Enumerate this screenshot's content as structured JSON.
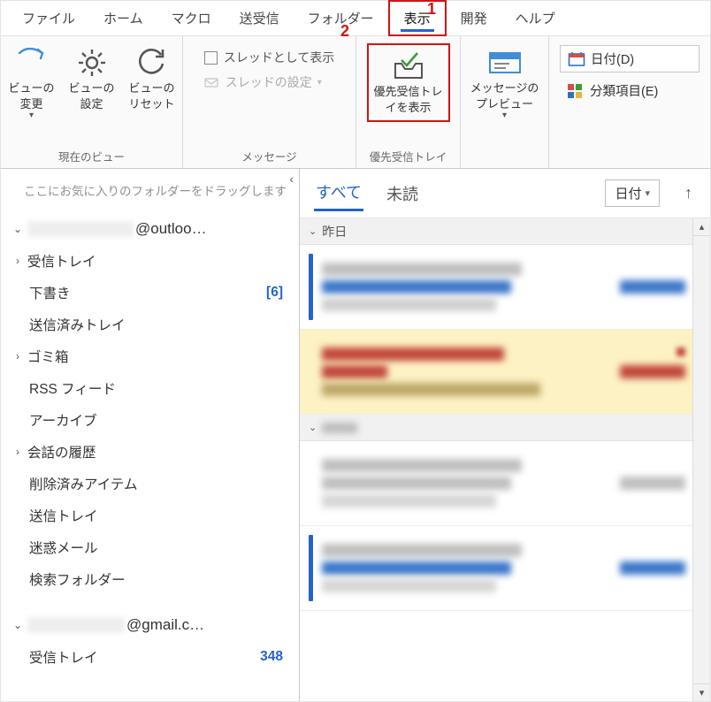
{
  "menubar": {
    "tabs": [
      "ファイル",
      "ホーム",
      "マクロ",
      "送受信",
      "フォルダー",
      "表示",
      "開発",
      "ヘルプ"
    ],
    "active_index": 5
  },
  "callouts": {
    "one": "1",
    "two": "2"
  },
  "ribbon": {
    "view_group": {
      "label": "現在のビュー",
      "change_view": "ビューの\n変更",
      "view_settings": "ビューの\n設定",
      "view_reset": "ビューの\nリセット"
    },
    "message_group": {
      "label": "メッセージ",
      "show_as_thread": "スレッドとして表示",
      "thread_settings": "スレッドの設定"
    },
    "focused_group": {
      "label": "優先受信トレイ",
      "btn": "優先受信トレ\nイを表示"
    },
    "preview_group": {
      "btn": "メッセージの\nプレビュー"
    },
    "arrange_group": {
      "date": "日付(D)",
      "category": "分類項目(E)"
    }
  },
  "nav": {
    "favorites_hint": "ここにお気に入りのフォルダーをドラッグします",
    "accounts": [
      {
        "display": "@outloo…",
        "folders": [
          {
            "name": "受信トレイ",
            "expandable": true
          },
          {
            "name": "下書き",
            "count": "[6]"
          },
          {
            "name": "送信済みトレイ"
          },
          {
            "name": "ゴミ箱",
            "expandable": true
          },
          {
            "name": "RSS フィード"
          },
          {
            "name": "アーカイブ"
          },
          {
            "name": "会話の履歴",
            "expandable": true
          },
          {
            "name": "削除済みアイテム"
          },
          {
            "name": "送信トレイ"
          },
          {
            "name": "迷惑メール"
          },
          {
            "name": "検索フォルダー"
          }
        ]
      },
      {
        "display": "@gmail.c…",
        "folders": [
          {
            "name": "受信トレイ",
            "count": "348"
          }
        ]
      }
    ]
  },
  "list": {
    "tab_all": "すべて",
    "tab_unread": "未読",
    "sort_label": "日付",
    "groups": [
      "昨日",
      ""
    ]
  }
}
